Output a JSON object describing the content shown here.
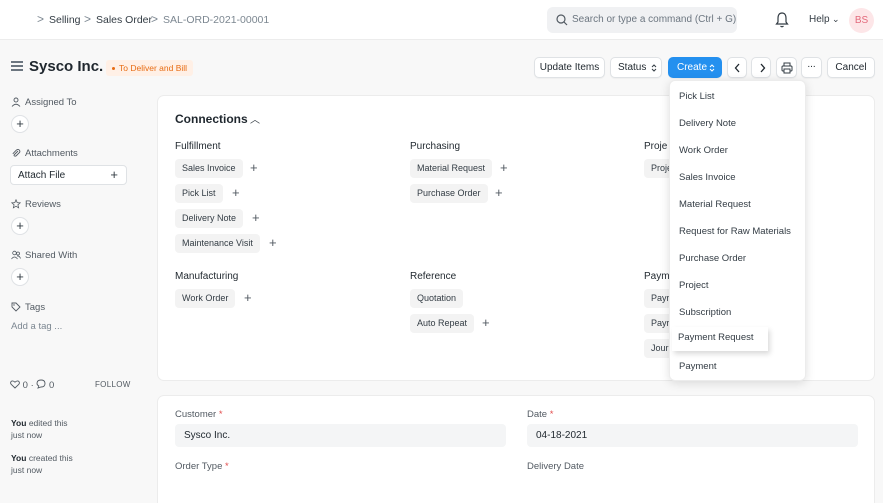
{
  "breadcrumb": {
    "items": [
      "Selling",
      "Sales Order",
      "SAL-ORD-2021-00001"
    ],
    "separator": ">"
  },
  "navbar": {
    "search_placeholder": "Search or type a command (Ctrl + G)",
    "help_label": "Help",
    "avatar_initials": "BS"
  },
  "page": {
    "title": "Sysco Inc.",
    "status": "To Deliver and Bill",
    "status_color": "#e86c13"
  },
  "toolbar": {
    "update_items": "Update Items",
    "status": "Status",
    "create": "Create",
    "cancel": "Cancel",
    "more": "...",
    "accent": "#2490ef"
  },
  "sidebar": {
    "assigned_to": "Assigned To",
    "attachments": "Attachments",
    "attach_file": "Attach File",
    "reviews": "Reviews",
    "shared_with": "Shared With",
    "tags": "Tags",
    "add_tag": "Add a tag ...",
    "likes": "0",
    "comments": "0",
    "follow": "FOLLOW",
    "timeline": [
      {
        "actor": "You",
        "action": "edited this",
        "when": "just now"
      },
      {
        "actor": "You",
        "action": "created this",
        "when": "just now"
      }
    ]
  },
  "connections": {
    "title": "Connections",
    "groups": {
      "fulfillment": {
        "label": "Fulfillment",
        "items": [
          "Sales Invoice",
          "Pick List",
          "Delivery Note",
          "Maintenance Visit"
        ]
      },
      "purchasing": {
        "label": "Purchasing",
        "items": [
          "Material Request",
          "Purchase Order"
        ]
      },
      "projects": {
        "label": "Proje",
        "items": [
          "Proje"
        ]
      },
      "manufacturing": {
        "label": "Manufacturing",
        "items": [
          "Work Order"
        ]
      },
      "reference": {
        "label": "Reference",
        "items": [
          "Quotation",
          "Auto Repeat"
        ]
      },
      "payments": {
        "label": "Paym",
        "items": [
          "Payr",
          "Payr",
          "Jour"
        ]
      }
    }
  },
  "form": {
    "customer_label": "Customer",
    "customer_value": "Sysco Inc.",
    "date_label": "Date",
    "date_value": "04-18-2021",
    "order_type_label": "Order Type",
    "delivery_date_label": "Delivery Date",
    "required_mark": "*"
  },
  "create_menu": {
    "items": [
      "Pick List",
      "Delivery Note",
      "Work Order",
      "Sales Invoice",
      "Material Request",
      "Request for Raw Materials",
      "Purchase Order",
      "Project",
      "Subscription",
      "Payment Request",
      "Payment"
    ],
    "hovered": "Payment Request"
  }
}
